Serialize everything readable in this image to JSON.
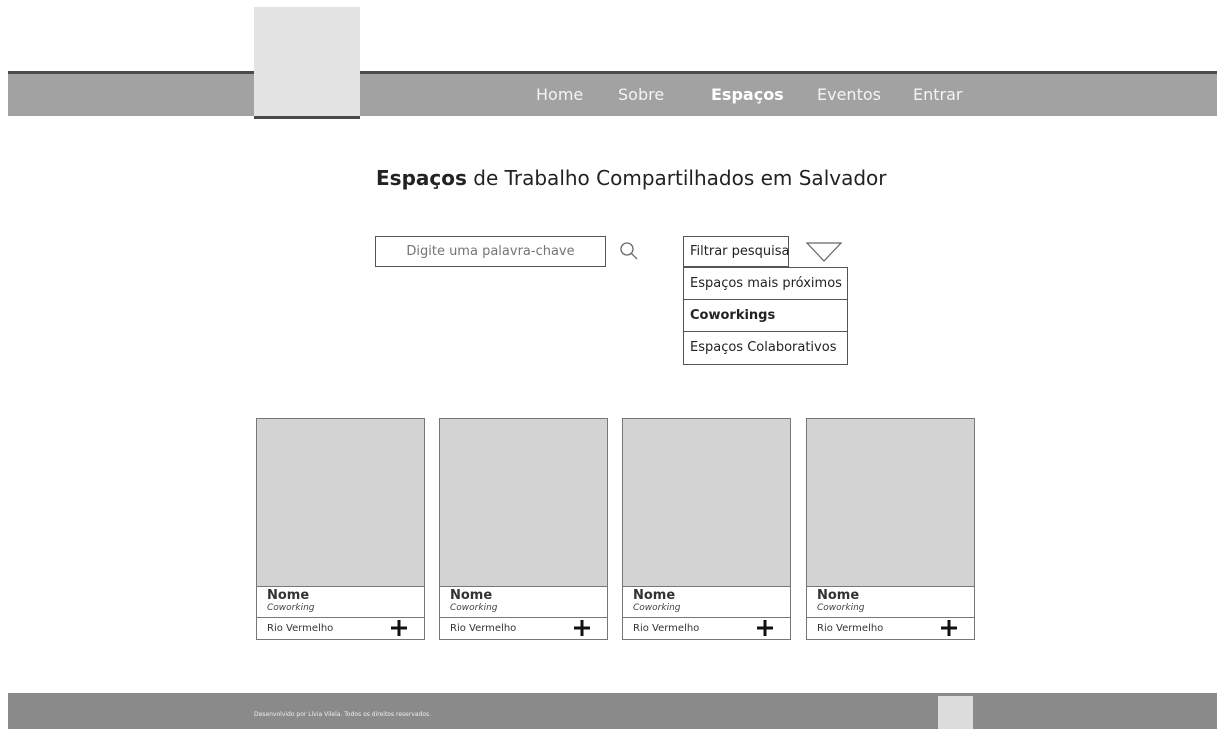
{
  "nav": {
    "items": [
      {
        "label": "Home"
      },
      {
        "label": "Sobre"
      },
      {
        "label": "Espaços",
        "active": true
      },
      {
        "label": "Eventos"
      },
      {
        "label": "Entrar"
      }
    ]
  },
  "main": {
    "title_bold": "Espaços",
    "title_rest": " de Trabalho Compartilhados em Salvador",
    "search": {
      "placeholder": "Digite uma palavra-chave"
    },
    "filter": {
      "label": "Filtrar pesquisa",
      "options": [
        "Espaços mais próximos",
        "Coworkings",
        "Espaços Colaborativos"
      ],
      "bold_option": "Coworkings"
    },
    "cards": [
      {
        "name": "Nome",
        "type": "Coworking",
        "location": "Rio Vermelho"
      },
      {
        "name": "Nome",
        "type": "Coworking",
        "location": "Rio Vermelho"
      },
      {
        "name": "Nome",
        "type": "Coworking",
        "location": "Rio Vermelho"
      },
      {
        "name": "Nome",
        "type": "Coworking",
        "location": "Rio Vermelho"
      }
    ]
  },
  "footer": {
    "text": "Desenvolvido por Lívia Vilela. Todos os direitos reservados."
  },
  "colors": {
    "header_bg": "#a2a2a2",
    "footer_bg": "#8a8a8a",
    "placeholder_gray": "#d3d3d3"
  }
}
